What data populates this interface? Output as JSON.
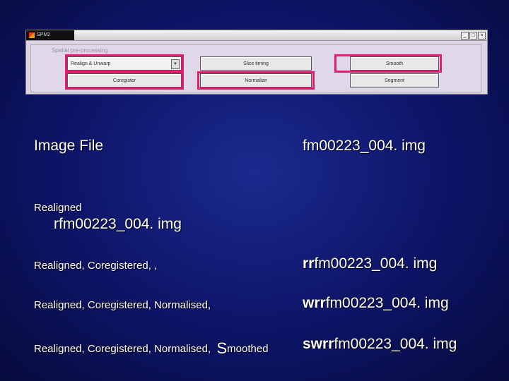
{
  "spm_window": {
    "title": "SPM2",
    "window_controls": [
      "_",
      "□",
      "×"
    ],
    "panel_label": "Spatial pre-processing",
    "select_value": "Realign & Unwarp",
    "buttons": {
      "slice_timing": "Slice timing",
      "smooth": "Smooth",
      "coregister": "Coregister",
      "normalize": "Normalize",
      "segment": "Segment"
    },
    "highlight_color": "#e31c6e"
  },
  "slide": {
    "image_file_label": "Image File",
    "image_file_value": "fm00223_004. img",
    "realigned_label": "Realigned",
    "realigned_value": "rfm00223_004. img",
    "coreg_label": "Realigned, Coregistered, ,",
    "coreg_value_prefix": "rr",
    "coreg_value_rest": "fm00223_004. img",
    "norm_label": "Realigned, Coregistered, Normalised,",
    "norm_value_prefix": "wrr",
    "norm_value_rest": "fm00223_004. img",
    "smooth_label": "Realigned, Coregistered, Normalised,",
    "smooth_s": "S",
    "smooth_rest": "moothed",
    "smooth_value_prefix": "swrr",
    "smooth_value_rest": "fm00223_004. img"
  },
  "colors": {
    "background": "#0d1466",
    "text": "#ffffff"
  }
}
